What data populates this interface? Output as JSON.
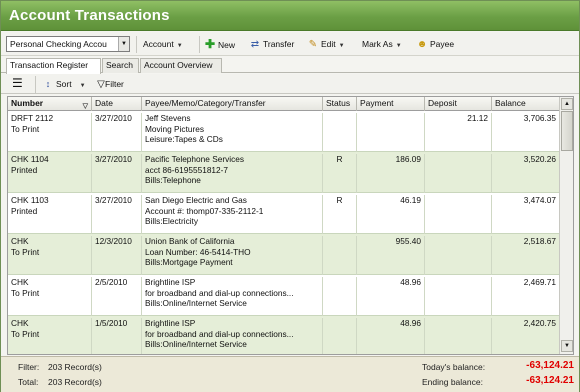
{
  "window": {
    "title": "Account Transactions"
  },
  "toolbar": {
    "account_selected": "Personal Checking Accou",
    "account_menu": "Account",
    "new_label": "New",
    "transfer_label": "Transfer",
    "edit_label": "Edit",
    "mark_as_label": "Mark As",
    "payee_label": "Payee"
  },
  "tabs": [
    {
      "label": "Transaction Register",
      "active": true
    },
    {
      "label": "Search",
      "active": false
    },
    {
      "label": "Account Overview",
      "active": false
    }
  ],
  "subtoolbar": {
    "sort_label": "Sort",
    "filter_label": "Filter"
  },
  "columns": [
    "Number",
    "Date",
    "Payee/Memo/Category/Transfer",
    "Status",
    "Payment",
    "Deposit",
    "Balance"
  ],
  "rows": [
    {
      "num1": "DRFT 2112",
      "num2": "To Print",
      "date": "3/27/2010",
      "p1": "Jeff Stevens",
      "p2": "Moving Pictures",
      "p3": "Leisure:Tapes & CDs",
      "status": "",
      "payment": "",
      "deposit": "21.12",
      "balance": "3,706.35"
    },
    {
      "num1": "CHK 1104",
      "num2": "Printed",
      "date": "3/27/2010",
      "p1": "Pacific Telephone Services",
      "p2": "acct 86-6195551812-7",
      "p3": "Bills:Telephone",
      "status": "R",
      "payment": "186.09",
      "deposit": "",
      "balance": "3,520.26"
    },
    {
      "num1": "CHK 1103",
      "num2": "Printed",
      "date": "3/27/2010",
      "p1": "San Diego Electric and Gas",
      "p2": "Account #: thomp07-335-2112-1",
      "p3": "Bills:Electricity",
      "status": "R",
      "payment": "46.19",
      "deposit": "",
      "balance": "3,474.07"
    },
    {
      "num1": "CHK",
      "num2": "To Print",
      "date": "12/3/2010",
      "p1": "Union Bank of California",
      "p2": "Loan Number: 46-5414-THO",
      "p3": "Bills:Mortgage Payment",
      "status": "",
      "payment": "955.40",
      "deposit": "",
      "balance": "2,518.67"
    },
    {
      "num1": "CHK",
      "num2": "To Print",
      "date": "2/5/2010",
      "p1": "Brightline ISP",
      "p2": "for broadband and dial-up connections...",
      "p3": "Bills:Online/Internet Service",
      "status": "",
      "payment": "48.96",
      "deposit": "",
      "balance": "2,469.71"
    },
    {
      "num1": "CHK",
      "num2": "To Print",
      "date": "1/5/2010",
      "p1": "Brightline ISP",
      "p2": "for broadband and dial-up connections...",
      "p3": "Bills:Online/Internet Service",
      "status": "",
      "payment": "48.96",
      "deposit": "",
      "balance": "2,420.75"
    }
  ],
  "footer": {
    "filter_label": "Filter:",
    "filter_value": "203 Record(s)",
    "total_label": "Total:",
    "total_value": "203 Record(s)",
    "todays_label": "Today's balance:",
    "todays_value": "-63,124.21",
    "ending_label": "Ending balance:",
    "ending_value": "-63,124.21"
  },
  "colors": {
    "title_green": "#6b9f45",
    "row_alt": "#e5eed8",
    "negative": "#e00000",
    "new_icon": "#2a9d2a"
  }
}
